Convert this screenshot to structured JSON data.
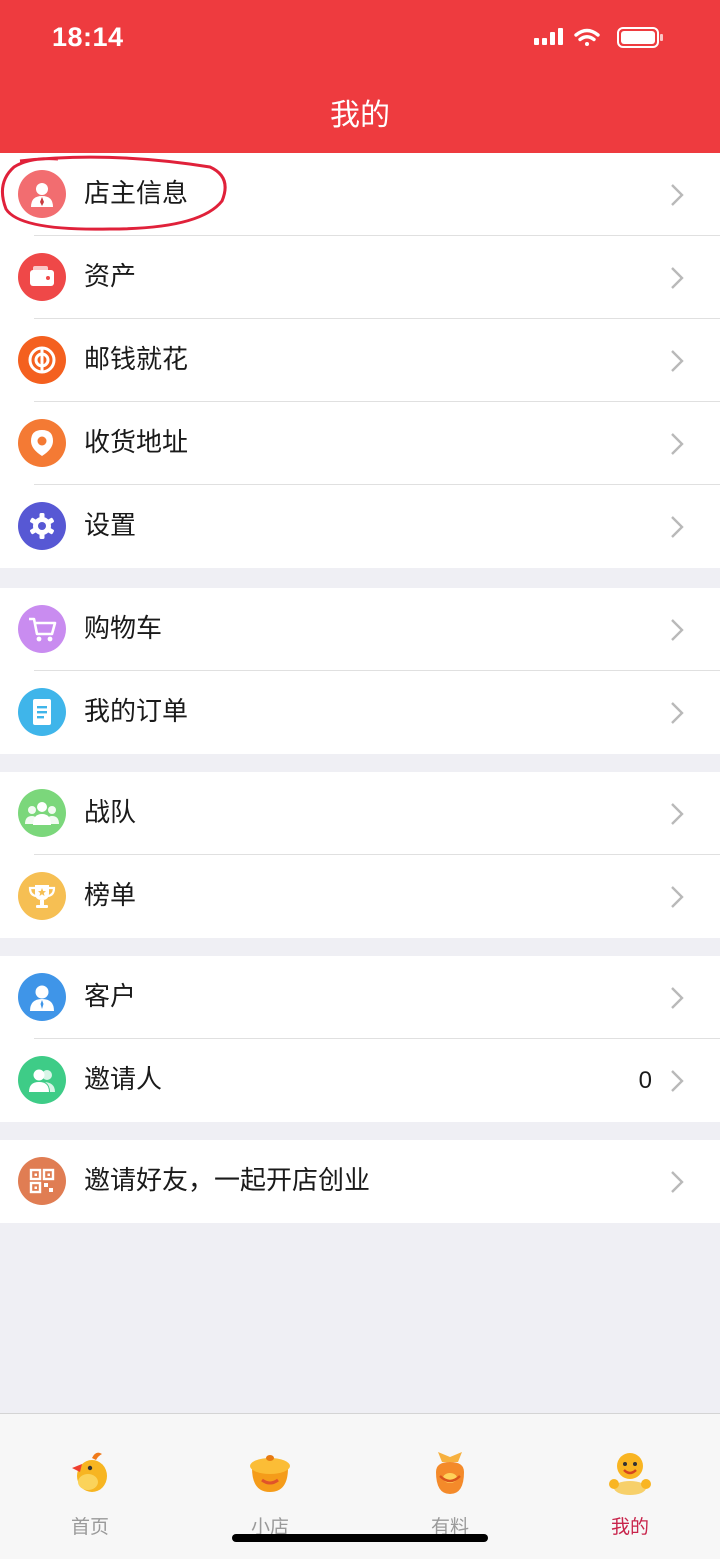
{
  "status_bar": {
    "time": "18:14"
  },
  "header": {
    "title": "我的"
  },
  "sections": [
    {
      "items": [
        {
          "label": "店主信息",
          "icon": "user-icon",
          "color": "#f26d70"
        },
        {
          "label": "资产",
          "icon": "wallet-icon",
          "color": "#ef4848"
        },
        {
          "label": "邮钱就花",
          "icon": "coin-icon",
          "color": "#f4601f"
        },
        {
          "label": "收货地址",
          "icon": "location-pin-icon",
          "color": "#f47a34"
        },
        {
          "label": "设置",
          "icon": "gear-icon",
          "color": "#5758d4"
        }
      ]
    },
    {
      "items": [
        {
          "label": "购物车",
          "icon": "cart-icon",
          "color": "#c98cf0"
        },
        {
          "label": "我的订单",
          "icon": "document-icon",
          "color": "#3fb5ea"
        }
      ]
    },
    {
      "items": [
        {
          "label": "战队",
          "icon": "team-icon",
          "color": "#7bd77b"
        },
        {
          "label": "榜单",
          "icon": "trophy-icon",
          "color": "#f6bf53"
        }
      ]
    },
    {
      "items": [
        {
          "label": "客户",
          "icon": "customer-icon",
          "color": "#3f95e8"
        },
        {
          "label": "邀请人",
          "icon": "people-icon",
          "color": "#3ecc87",
          "value": "0"
        }
      ]
    },
    {
      "items": [
        {
          "label": "邀请好友，一起开店创业",
          "icon": "qr-code-icon",
          "color": "#e07d53"
        }
      ]
    }
  ],
  "tabbar": {
    "tabs": [
      {
        "label": "首页",
        "icon": "chick-icon",
        "active": false
      },
      {
        "label": "小店",
        "icon": "shop-pot-icon",
        "active": false
      },
      {
        "label": "有料",
        "icon": "treasure-bag-icon",
        "active": false
      },
      {
        "label": "我的",
        "icon": "mascot-icon",
        "active": true
      }
    ],
    "active_color": "#c8244b"
  },
  "colors": {
    "header": "#ee3b3f",
    "background": "#efeff4"
  }
}
